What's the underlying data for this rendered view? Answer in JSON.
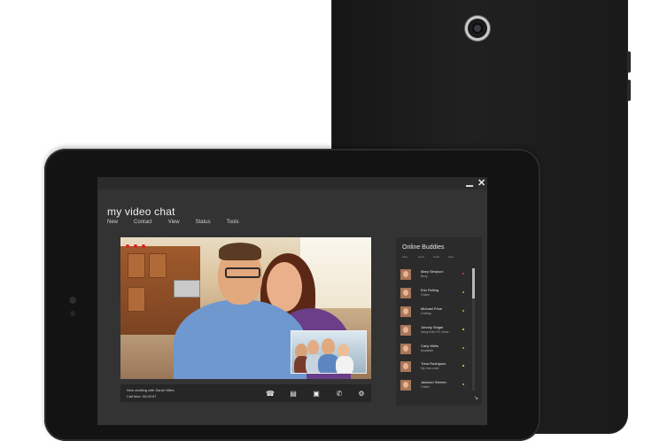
{
  "app": {
    "title": "my video chat",
    "window_controls": {
      "minimize": "–",
      "close": "✕"
    }
  },
  "menu": [
    "New",
    "Contact",
    "View",
    "Status",
    "Tools"
  ],
  "call": {
    "status_line1": "Now chatting with Sarah Miles",
    "status_line2": "Call time: 00:00:07",
    "controls": [
      {
        "name": "phone-icon",
        "glyph": "☎"
      },
      {
        "name": "message-icon",
        "glyph": "▤"
      },
      {
        "name": "camera-icon",
        "glyph": "▣"
      },
      {
        "name": "call-transfer-icon",
        "glyph": "✆"
      },
      {
        "name": "gear-icon",
        "glyph": "⚙"
      }
    ]
  },
  "buddies": {
    "title": "Online Buddies",
    "tabs": [
      "Files",
      "Send",
      "Tools",
      "Help"
    ],
    "items": [
      {
        "name": "Mary Simpson",
        "status": "Busy",
        "color": "#e03b3b"
      },
      {
        "name": "Eric Rolling",
        "status": "Online",
        "color": "#7fd13b"
      },
      {
        "name": "Michael Price",
        "status": "Chilling",
        "color": "#7fd13b"
      },
      {
        "name": "Johnny Singer",
        "status": "Away from PC since...",
        "color": "#e8e05a"
      },
      {
        "name": "Carly Wells",
        "status": "Available",
        "color": "#7fd13b"
      },
      {
        "name": "Trina Rodriguez",
        "status": "My new color",
        "color": "#e8e05a"
      },
      {
        "name": "Jackson Sterner",
        "status": "Online",
        "color": "#7fd13b"
      }
    ]
  },
  "colors": {
    "record_indicator": "#e02424",
    "screen_bg": "#333333",
    "panel_bg": "#2b2b2b"
  }
}
